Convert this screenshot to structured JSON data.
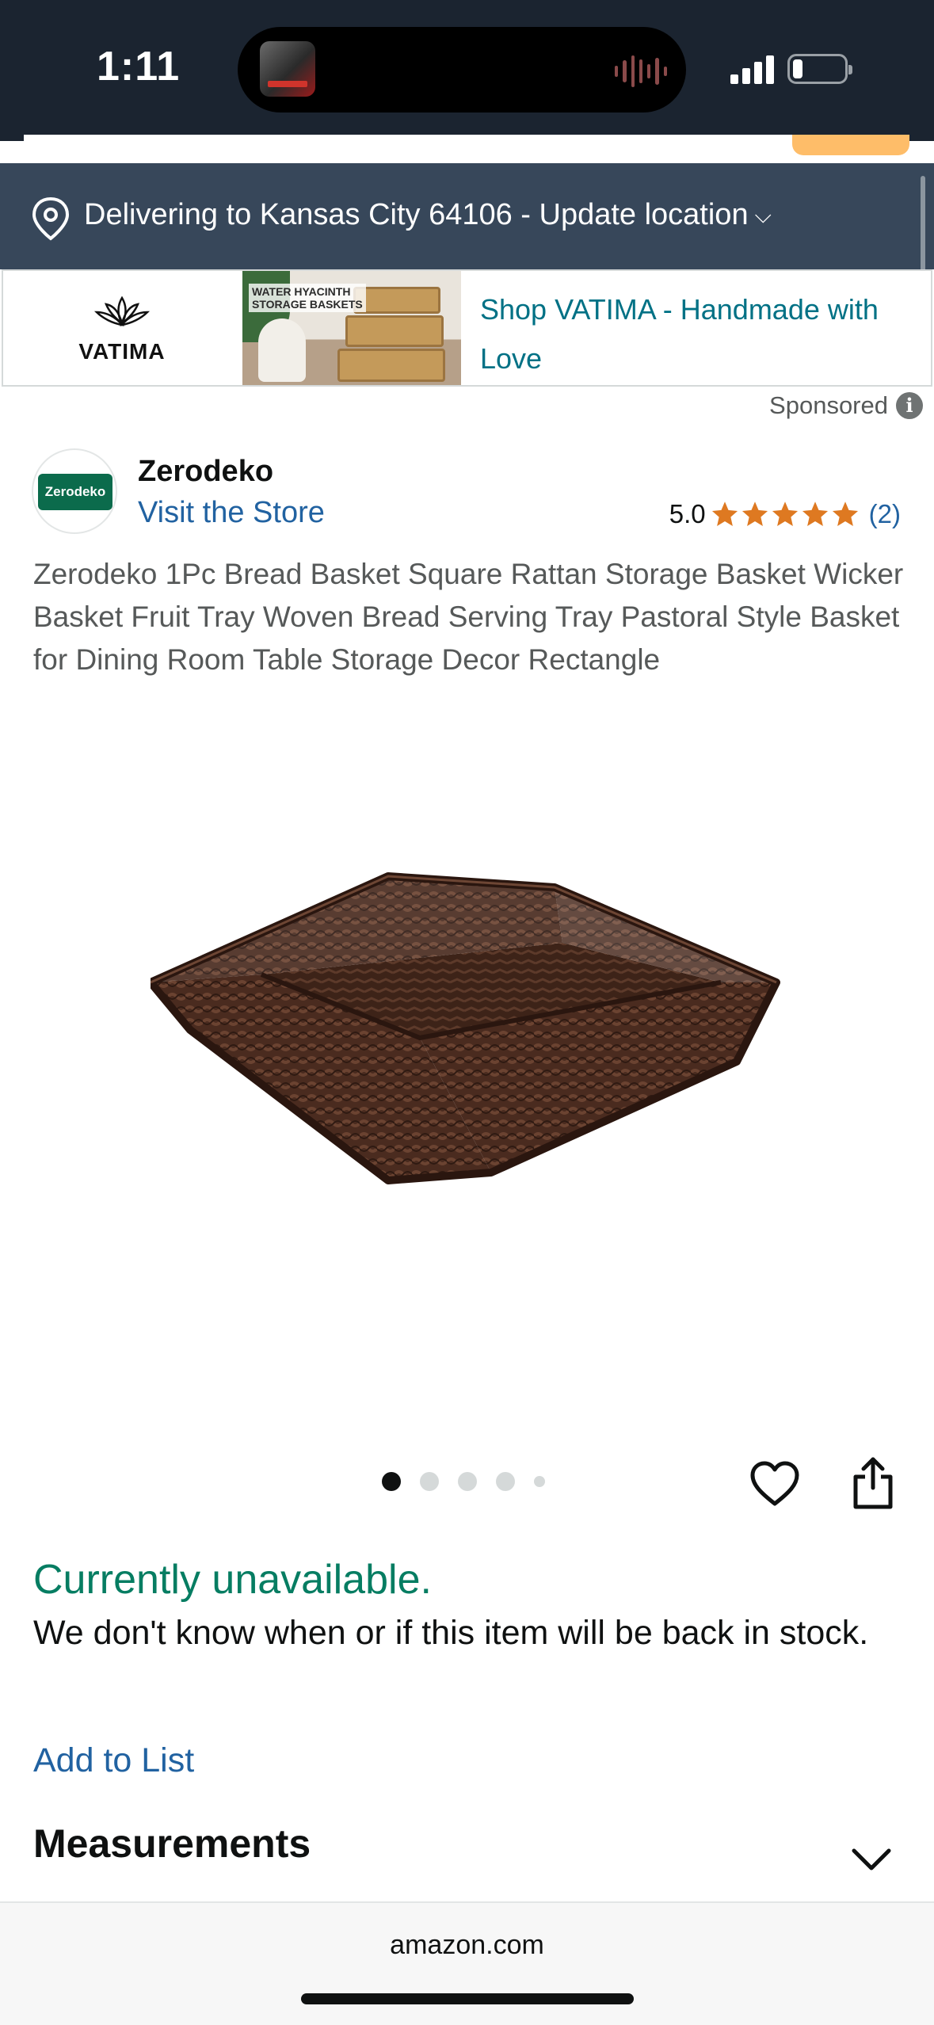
{
  "status_bar": {
    "time": "1:11",
    "icons": [
      "now-playing-thumbnail",
      "audio-waveform-icon",
      "cellular-signal-icon",
      "battery-icon"
    ]
  },
  "delivery": {
    "text": "Delivering to Kansas City 64106 - Update location",
    "chevron": "⌵",
    "icon": "location-pin-icon"
  },
  "ad": {
    "brand": "VATIMA",
    "image_caption_line1": "WATER HYACINTH",
    "image_caption_line2": "STORAGE BASKETS",
    "text": "Shop VATIMA - Handmade with Love",
    "sponsored_label": "Sponsored",
    "info_glyph": "i"
  },
  "store": {
    "logo_text": "Zerodeko",
    "name": "Zerodeko",
    "visit_label": "Visit the Store",
    "rating_value": "5.0",
    "stars": 5,
    "review_count": "(2)"
  },
  "product": {
    "title": "Zerodeko 1Pc Bread Basket Square Rattan Storage Basket Wicker Basket Fruit Tray Woven Bread Serving Tray Pastoral Style Basket for Dining Room Table Storage Decor Rectangle",
    "image_count": 5,
    "active_image": 1
  },
  "availability": {
    "status": "Currently unavailable.",
    "description": "We don't know when or if this item will be back in stock.",
    "add_to_list": "Add to List"
  },
  "sections": {
    "measurements": "Measurements"
  },
  "browser": {
    "url": "amazon.com"
  },
  "colors": {
    "status_bar_bg": "#1b2430",
    "delivery_bg": "#37475a",
    "link": "#2162a1",
    "ad_link": "#007185",
    "unavailable": "#067d62",
    "star": "#de7921"
  }
}
